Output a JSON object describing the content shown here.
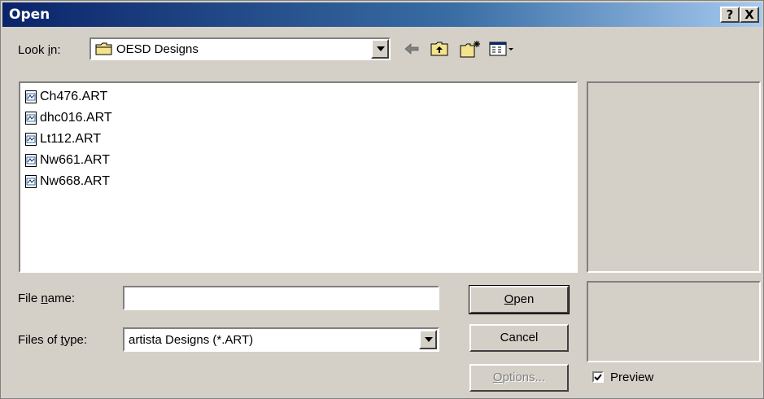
{
  "dialog": {
    "title": "Open",
    "help_button": "?",
    "close_button": "X"
  },
  "look_in": {
    "label_pre": "Look ",
    "label_accel": "i",
    "label_post": "n:",
    "value": "OESD Designs",
    "folder_icon": "folder-icon"
  },
  "toolbar": {
    "back_icon": "back-arrow-icon",
    "up_icon": "up-one-level-icon",
    "new_folder_icon": "new-folder-icon",
    "view_icon": "view-menu-icon"
  },
  "files": [
    {
      "name": "Ch476.ART"
    },
    {
      "name": "dhc016.ART"
    },
    {
      "name": "Lt112.ART"
    },
    {
      "name": "Nw661.ART"
    },
    {
      "name": "Nw668.ART"
    }
  ],
  "file_name": {
    "label_pre": "File ",
    "label_accel": "n",
    "label_post": "ame:",
    "value": ""
  },
  "file_type": {
    "label_pre": "Files of ",
    "label_accel": "t",
    "label_post": "ype:",
    "value": "artista Designs (*.ART)"
  },
  "buttons": {
    "open_accel": "O",
    "open_rest": "pen",
    "cancel": "Cancel",
    "options_accel": "O",
    "options_rest": "ptions..."
  },
  "preview": {
    "label": "Preview",
    "checked": true
  },
  "colors": {
    "face": "#d4d0c8",
    "title_start": "#0a246a",
    "title_end": "#a6caf0"
  }
}
